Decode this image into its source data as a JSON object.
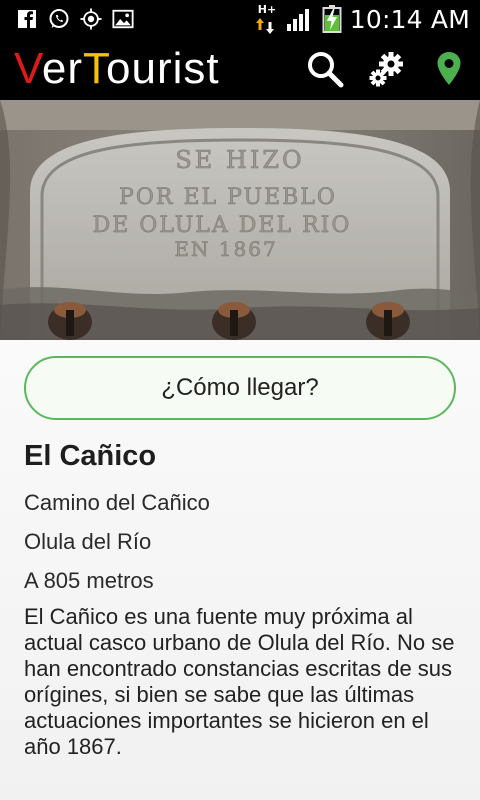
{
  "status_bar": {
    "time": "10:14 AM",
    "network_label": "H+",
    "icons": [
      "facebook-icon",
      "whatsapp-icon",
      "gps-icon",
      "image-icon",
      "data-arrows-icon",
      "signal-icon",
      "battery-charging-icon"
    ]
  },
  "app_bar": {
    "title_first_letter": "V",
    "title_part1": "er",
    "title_second_cap": "T",
    "title_part2": "ourist",
    "actions": [
      "search-icon",
      "settings-icon",
      "location-pin-icon"
    ],
    "colors": {
      "v": "#e01a1a",
      "t": "#f3c20b",
      "pin": "#4caf50"
    }
  },
  "hero": {
    "inscription_lines": [
      "SE HIZO",
      "POR EL PUEBLO",
      "DE OLULA DEL RIO",
      "EN 1867"
    ]
  },
  "detail": {
    "route_button": "¿Cómo llegar?",
    "name": "El Cañico",
    "address": "Camino del Cañico",
    "town": "Olula del Río",
    "distance": "A 805 metros",
    "description": "El Cañico es una fuente muy próxima al actual casco urbano de Olula del Río. No se han encontrado constancias escritas de sus orígines, si bien se sabe que las últimas actuaciones importantes se hicieron en el año 1867."
  }
}
